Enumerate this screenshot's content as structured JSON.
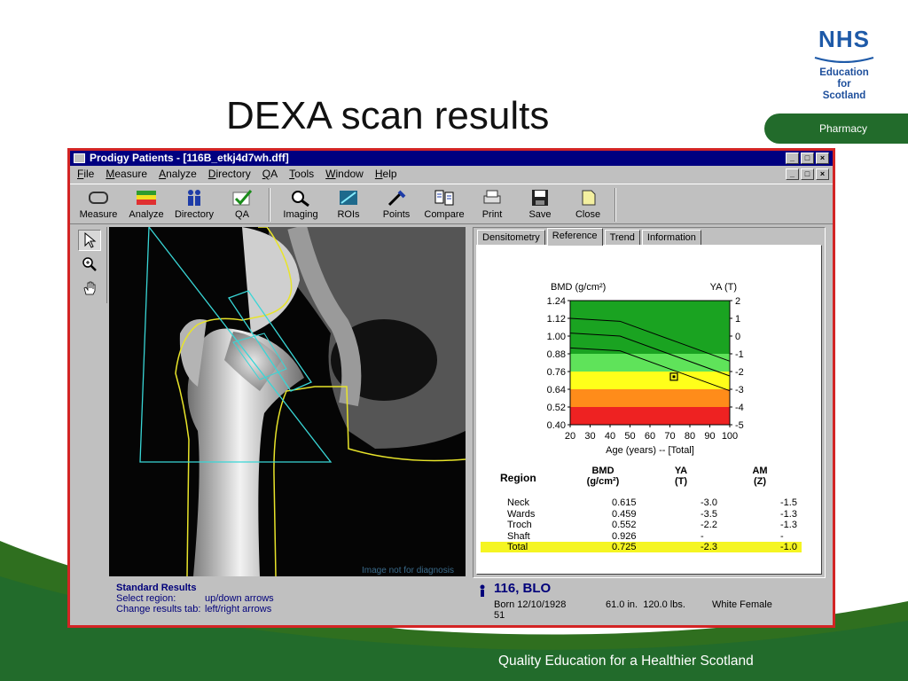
{
  "slide": {
    "title": "DEXA scan results",
    "logo": {
      "mark": "NHS",
      "lines": [
        "Education",
        "for",
        "Scotland"
      ]
    },
    "section_tab": "Pharmacy",
    "footer": "Quality Education for a Healthier Scotland",
    "colors": {
      "nhs_blue": "#1e5aa8",
      "green": "#226b2b",
      "frame_red": "#d32424"
    }
  },
  "app": {
    "title": "Prodigy Patients - [116B_etkj4d7wh.dff]",
    "window_buttons": [
      "_",
      "□",
      "×"
    ],
    "menu": [
      "File",
      "Measure",
      "Analyze",
      "Directory",
      "QA",
      "Tools",
      "Window",
      "Help"
    ],
    "toolbar": [
      {
        "label": "Measure",
        "icon": "measure-icon"
      },
      {
        "label": "Analyze",
        "icon": "analyze-icon"
      },
      {
        "label": "Directory",
        "icon": "directory-icon"
      },
      {
        "label": "QA",
        "icon": "qa-check-icon"
      },
      {
        "label": "Imaging",
        "icon": "imaging-icon"
      },
      {
        "label": "ROIs",
        "icon": "rois-icon"
      },
      {
        "label": "Points",
        "icon": "points-icon"
      },
      {
        "label": "Compare",
        "icon": "compare-icon"
      },
      {
        "label": "Print",
        "icon": "print-icon"
      },
      {
        "label": "Save",
        "icon": "save-icon"
      },
      {
        "label": "Close",
        "icon": "close-file-icon"
      }
    ],
    "side_tools": [
      {
        "icon": "pointer-arrow-icon",
        "selected": true
      },
      {
        "icon": "zoom-icon",
        "selected": false
      },
      {
        "icon": "hand-pan-icon",
        "selected": false
      }
    ],
    "scan_watermark": "Image not for diagnosis",
    "tabs": [
      "Densitometry",
      "Reference",
      "Trend",
      "Information"
    ],
    "active_tab": "Reference",
    "status": {
      "title": "Standard Results",
      "lines": [
        {
          "label": "Select region:",
          "value": "up/down arrows"
        },
        {
          "label": "Change results tab:",
          "value": "left/right arrows"
        }
      ]
    },
    "patient": {
      "id": "116, BLO",
      "born": "Born 12/10/1928",
      "age": "51",
      "measurements": "61.0 in.  120.0 lbs.",
      "sex": "White Female"
    },
    "results_table": {
      "headers": {
        "region": "Region",
        "bmd": "BMD",
        "bmd_unit": "(g/cm²)",
        "ya": "YA",
        "ya_unit": "(T)",
        "am": "AM",
        "am_unit": "(Z)"
      },
      "rows": [
        {
          "region": "Neck",
          "bmd": "0.615",
          "ya": "-3.0",
          "am": "-1.5",
          "highlight": false
        },
        {
          "region": "Wards",
          "bmd": "0.459",
          "ya": "-3.5",
          "am": "-1.3",
          "highlight": false
        },
        {
          "region": "Troch",
          "bmd": "0.552",
          "ya": "-2.2",
          "am": "-1.3",
          "highlight": false
        },
        {
          "region": "Shaft",
          "bmd": "0.926",
          "ya": "-",
          "am": "-",
          "highlight": false
        },
        {
          "region": "Total",
          "bmd": "0.725",
          "ya": "-2.3",
          "am": "-1.0",
          "highlight": true
        }
      ]
    }
  },
  "chart_data": {
    "type": "line",
    "ylabel": "BMD (g/cm²)",
    "y2label": "YA (T)",
    "xlabel": "Age (years) -- [Total]",
    "x_ticks": [
      20,
      30,
      40,
      50,
      60,
      70,
      80,
      90,
      100
    ],
    "y_ticks": [
      "1.24",
      "1.12",
      "1.00",
      "0.88",
      "0.76",
      "0.64",
      "0.52",
      "0.40"
    ],
    "y2_ticks": [
      "2",
      "1",
      "0",
      "-1",
      "-2",
      "-3",
      "-4",
      "-5"
    ],
    "xlim": [
      20,
      100
    ],
    "ylim": [
      0.4,
      1.24
    ],
    "bands": [
      {
        "from": 0.88,
        "to": 1.24,
        "color": "#1aa321"
      },
      {
        "from": 0.76,
        "to": 0.88,
        "color": "#5fe35a"
      },
      {
        "from": 0.64,
        "to": 0.76,
        "color": "#ffff1a"
      },
      {
        "from": 0.52,
        "to": 0.64,
        "color": "#ff8c1a"
      },
      {
        "from": 0.4,
        "to": 0.52,
        "color": "#ee2222"
      }
    ],
    "series": [
      {
        "x": [
          20,
          45,
          100
        ],
        "y": [
          1.12,
          1.1,
          0.83
        ]
      },
      {
        "x": [
          20,
          45,
          100
        ],
        "y": [
          1.02,
          1.0,
          0.73
        ]
      },
      {
        "x": [
          20,
          45,
          100
        ],
        "y": [
          0.92,
          0.9,
          0.63
        ]
      }
    ],
    "patient_point": {
      "x": 72,
      "y": 0.725
    }
  }
}
